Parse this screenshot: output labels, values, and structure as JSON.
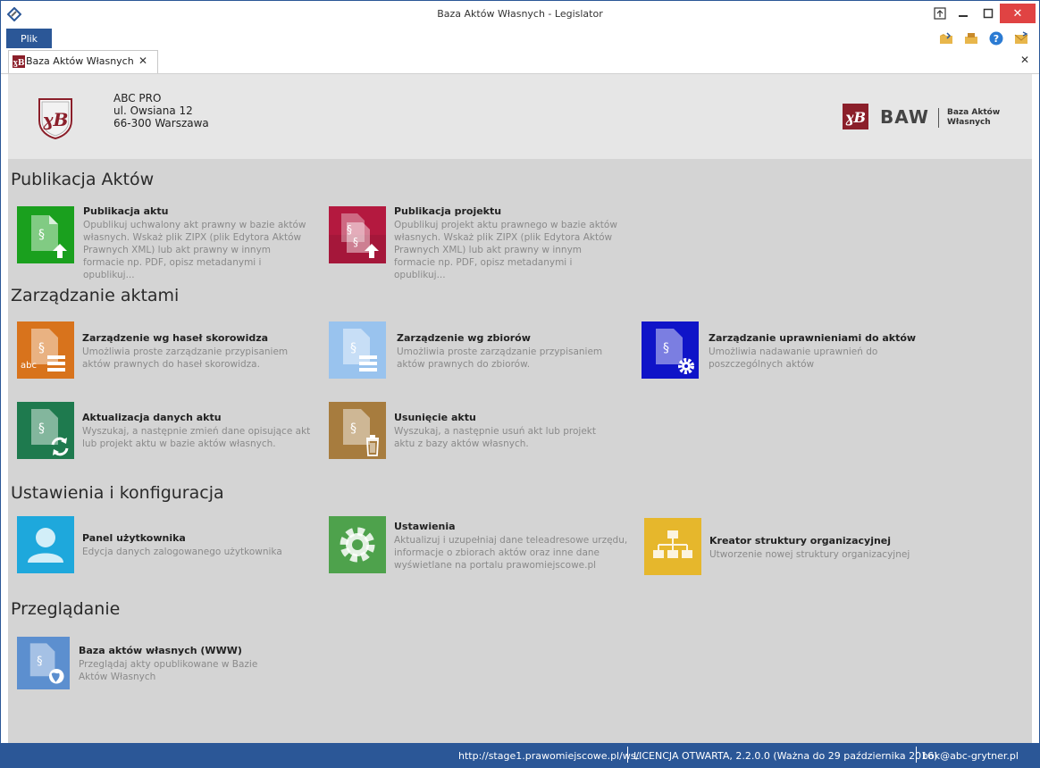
{
  "window": {
    "title": "Baza Aktów Własnych - Legislator",
    "controls": {
      "restore": "⧉",
      "minimize": "—",
      "maximize": "☐",
      "close": "✕"
    }
  },
  "menu": {
    "plik_label": "Plik"
  },
  "tab": {
    "label": "Baza Aktów Własnych",
    "close": "✕",
    "close_all": "✕"
  },
  "header": {
    "org_lines": [
      "ABC PRO",
      "ul. Owsiana 12",
      "66-300 Warszawa"
    ],
    "brand": "BAW",
    "brand_sub": [
      "Baza Aktów",
      "Własnych"
    ]
  },
  "sections": [
    {
      "title": "Publikacja Aktów",
      "items": [
        {
          "title": "Publikacja aktu",
          "desc": "Opublikuj uchwalony akt prawny w bazie aktów własnych. Wskaż plik ZIPX (plik Edytora Aktów Prawnych XML) lub akt prawny w innym formacie np. PDF, opisz metadanymi i opublikuj...",
          "color": "#1aa01e",
          "icon": "doc-upload-icon"
        },
        {
          "title": "Publikacja projektu",
          "desc": "Opublikuj projekt aktu prawnego w bazie aktów własnych. Wskaż plik ZIPX (plik Edytora Aktów Prawnych XML) lub akt prawny w innym formacie np. PDF, opisz metadanymi i opublikuj...",
          "color": "#b4193f",
          "icon": "doc-stack-upload-icon"
        }
      ]
    },
    {
      "title": "Zarządzanie aktami",
      "items": [
        {
          "title": "Zarządzenie wg haseł skorowidza",
          "desc": "Umożliwia proste zarządzanie przypisaniem aktów prawnych do haseł skorowidza.",
          "color": "#d8731c",
          "icon": "doc-index-icon",
          "badge": "abc"
        },
        {
          "title": "Zarządzenie wg zbiorów",
          "desc": "Umożliwia proste zarządzanie przypisaniem aktów prawnych do zbiorów.",
          "color": "#99c3ee",
          "icon": "doc-list-icon"
        },
        {
          "title": "Zarządzanie uprawnieniami do aktów",
          "desc": "Umożliwia nadawanie uprawnień do poszczególnych aktów",
          "color": "#0f14c8",
          "icon": "doc-gear-icon"
        },
        {
          "title": "Aktualizacja danych aktu",
          "desc": "Wyszukaj, a następnie zmień dane opisujące akt lub projekt aktu w bazie aktów własnych.",
          "color": "#1e7a4e",
          "icon": "doc-refresh-icon"
        },
        {
          "title": "Usunięcie aktu",
          "desc": "Wyszukaj, a następnie usuń akt lub projekt aktu z bazy aktów własnych.",
          "color": "#a77c3e",
          "icon": "doc-trash-icon"
        }
      ]
    },
    {
      "title": "Ustawienia i konfiguracja",
      "items": [
        {
          "title": "Panel użytkownika",
          "desc": "Edycja danych zalogowanego użytkownika",
          "color": "#1ea8dc",
          "icon": "user-icon"
        },
        {
          "title": "Ustawienia",
          "desc": "Aktualizuj i uzupełniaj dane teleadresowe urzędu, informacje o zbiorach aktów oraz inne dane wyświetlane na portalu prawomiejscowe.pl",
          "color": "#4ea24c",
          "icon": "gear-icon"
        },
        {
          "title": "Kreator struktury organizacyjnej",
          "desc": "Utworzenie nowej struktury organizacyjnej",
          "color": "#e6b72c",
          "icon": "org-chart-icon"
        }
      ]
    },
    {
      "title": "Przeglądanie",
      "items": [
        {
          "title": "Baza aktów własnych (WWW)",
          "desc": "Przeglądaj akty opublikowane w Bazie Aktów Własnych",
          "color": "#5c8fcf",
          "icon": "doc-globe-icon"
        }
      ]
    }
  ],
  "status": {
    "url": "http://stage1.prawomiejscowe.pl/ws/",
    "license": "LICENCJA OTWARTA, 2.2.0.0 (Ważna do 29 października 2016)",
    "email": "bok@abc-grytner.pl"
  },
  "brand_colors": {
    "accent": "#2b5797",
    "logo_red": "#8b1f2a"
  }
}
